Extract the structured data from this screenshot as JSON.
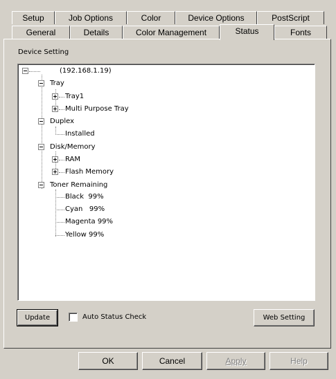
{
  "tabs": {
    "back_row": [
      "Setup",
      "Job Options",
      "Color",
      "Device Options",
      "PostScript"
    ],
    "front_row": [
      "General",
      "Details",
      "Color Management",
      "Status",
      "Fonts"
    ],
    "active": "Status"
  },
  "section_label": "Device Setting",
  "tree": {
    "root": "(192.168.1.19)",
    "tray": "Tray",
    "tray1": "Tray1",
    "multi_purpose_tray": "Multi Purpose Tray",
    "duplex": "Duplex",
    "installed": "Installed",
    "disk_memory": "Disk/Memory",
    "ram": "RAM",
    "flash_memory": "Flash Memory",
    "toner_remaining": "Toner Remaining",
    "black": "Black  99%",
    "cyan": "Cyan   99%",
    "magenta": "Magenta 99%",
    "yellow": "Yellow 99%"
  },
  "controls": {
    "update": "Update",
    "auto_status_check": "Auto Status Check",
    "auto_status_checked": false,
    "web_setting": "Web Setting"
  },
  "footer": {
    "ok": "OK",
    "cancel": "Cancel",
    "apply": "Apply",
    "help": "Help"
  },
  "colors": {
    "face": "#d4d0c8",
    "window": "#ffffff",
    "disabled_text": "#808080"
  }
}
